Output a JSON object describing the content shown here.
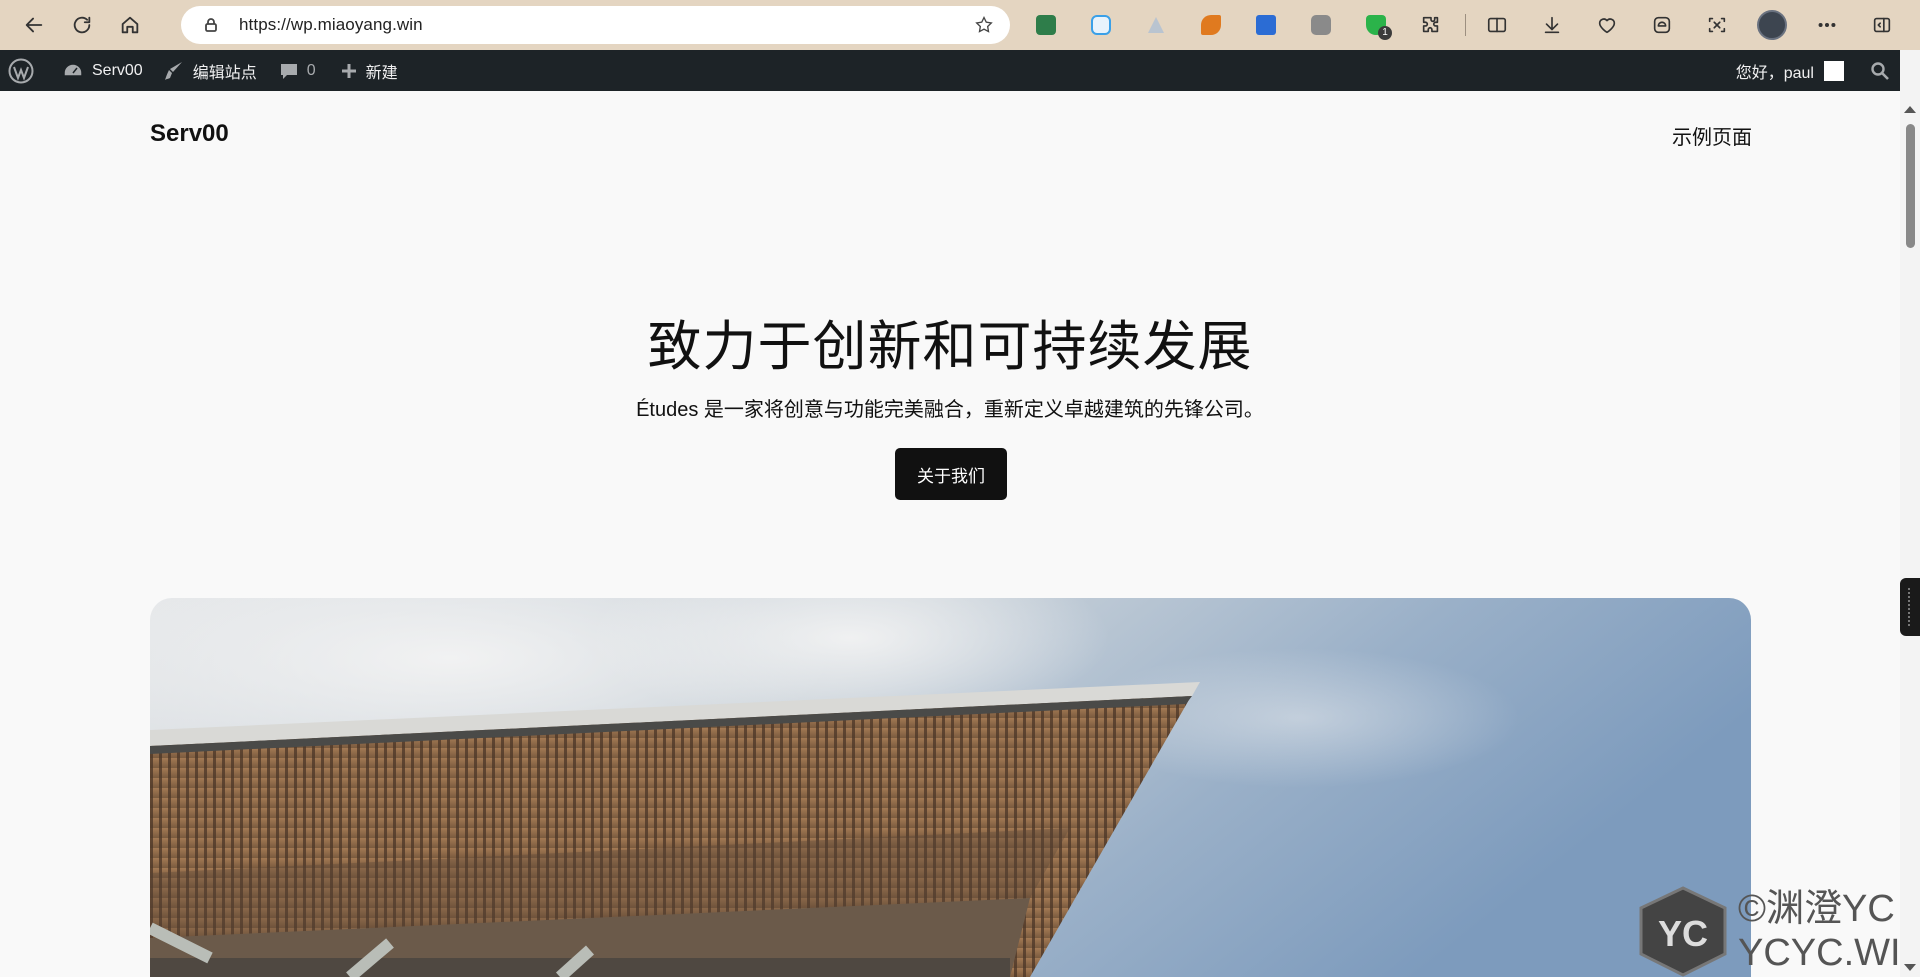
{
  "browser": {
    "url": "https://wp.miaoyang.win",
    "extensions": [
      {
        "name": "download-extension-icon",
        "color": "#2e7d4a",
        "badge": ""
      },
      {
        "name": "cloud-extension-icon",
        "color": "#3aa0e8",
        "badge": ""
      },
      {
        "name": "triangle-extension-icon",
        "color": "#b9c4d0",
        "badge": ""
      },
      {
        "name": "puzzle-orange-extension-icon",
        "color": "#e07a1f",
        "badge": ""
      },
      {
        "name": "blue-card-extension-icon",
        "color": "#2b6cd4",
        "badge": ""
      },
      {
        "name": "camera-extension-icon",
        "color": "#8a8a8a",
        "badge": ""
      },
      {
        "name": "shield-check-extension-icon",
        "color": "#2bb34a",
        "badge": "1"
      }
    ]
  },
  "admin_bar": {
    "site_name": "Serv00",
    "edit_site": "编辑站点",
    "comments_count": "0",
    "new_label": "新建",
    "greeting": "您好，paul"
  },
  "site": {
    "title": "Serv00",
    "nav_link": "示例页面"
  },
  "hero": {
    "heading": "致力于创新和可持续发展",
    "description": "Études 是一家将创意与功能完美融合，重新定义卓越建筑的先锋公司。",
    "button": "关于我们"
  },
  "watermark": {
    "line1": "©渊澄YC",
    "line2": "YCYC.WIN",
    "logo_text": "YC"
  }
}
